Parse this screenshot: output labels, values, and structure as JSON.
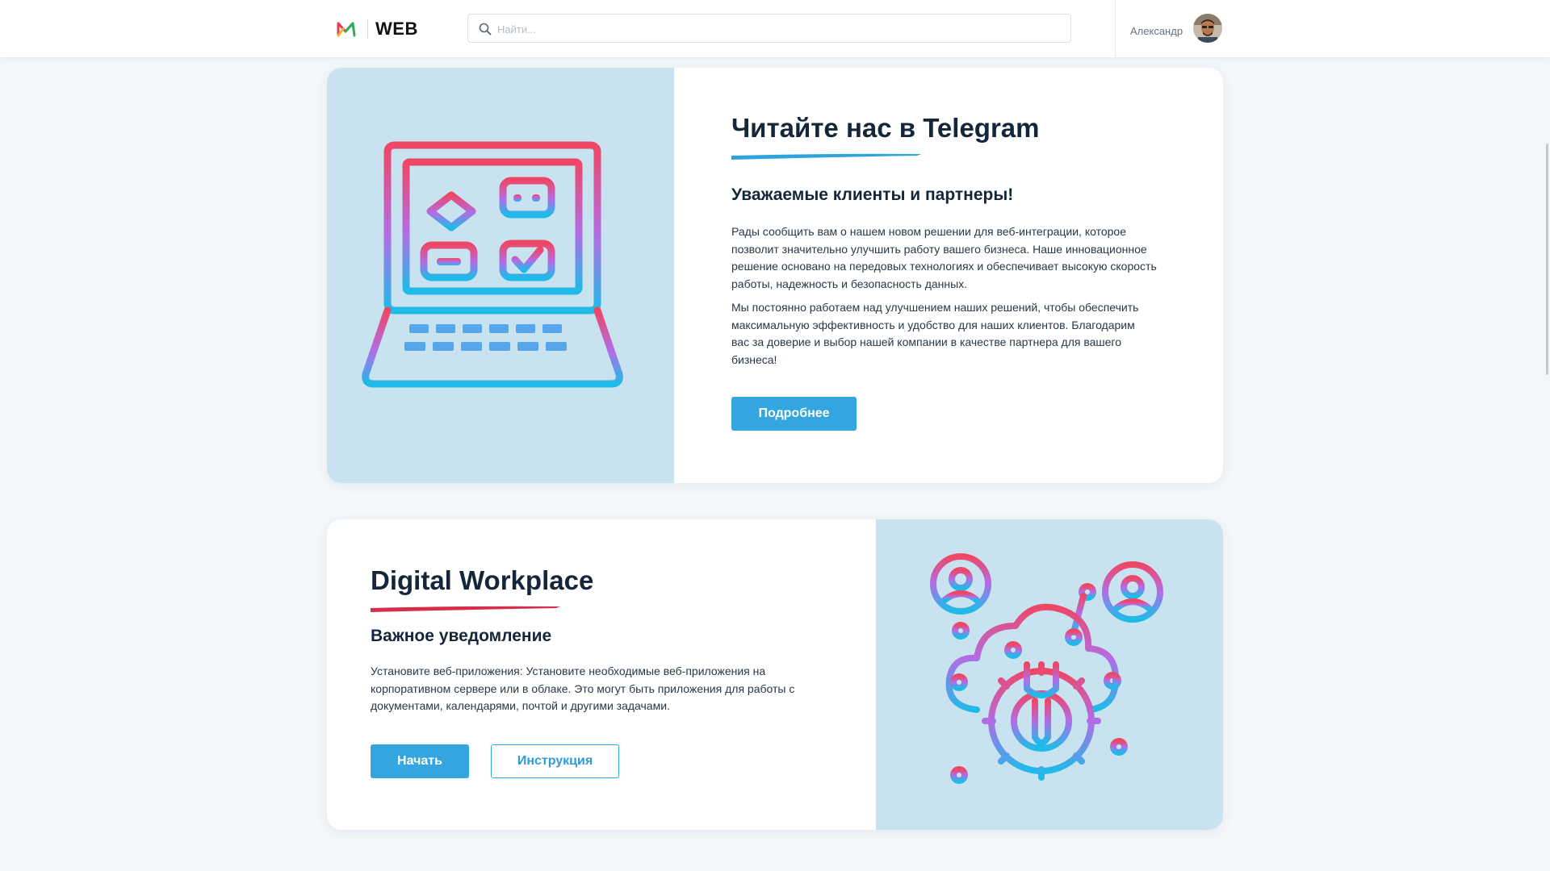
{
  "header": {
    "brand": "WEB",
    "search_placeholder": "Найти...",
    "user_name": "Александр"
  },
  "card_telegram": {
    "title": "Читайте нас в Telegram",
    "subtitle": "Уважаемые клиенты и партнеры!",
    "paragraphs": [
      "Рады сообщить вам о нашем новом решении для веб-интеграции, которое позволит значительно улучшить работу вашего бизнеса. Наше инновационное решение основано на передовых технологиях и обеспечивает высокую скорость работы, надежность и безопасность данных.",
      "Мы постоянно работаем над улучшением наших решений, чтобы обеспечить максимальную эффективность и удобство для наших клиентов. Благодарим вас за доверие и выбор нашей компании в качестве партнера для вашего бизнеса!"
    ],
    "button_label": "Подробнее",
    "underline_color": "#2fa3dc"
  },
  "card_workplace": {
    "title": "Digital Workplace",
    "subtitle": "Важное уведомление",
    "paragraph": "Установите веб-приложения: Установите необходимые веб-приложения на корпоративном сервере или в облаке. Это могут быть приложения для работы с документами, календарями, почтой и другими задачами.",
    "primary_button_label": "Начать",
    "secondary_button_label": "Инструкция",
    "underline_color": "#d62e4a"
  },
  "colors": {
    "primary": "#34a5de",
    "illustration_background": "#c9e2ef",
    "gradient_top": "#ee4766",
    "gradient_middle": "#b16de6",
    "gradient_bottom": "#1fbbe8"
  },
  "icons": [
    "logo-icon",
    "search-icon",
    "avatar",
    "laptop-flowchart-icon",
    "cloud-gear-network-icon"
  ]
}
